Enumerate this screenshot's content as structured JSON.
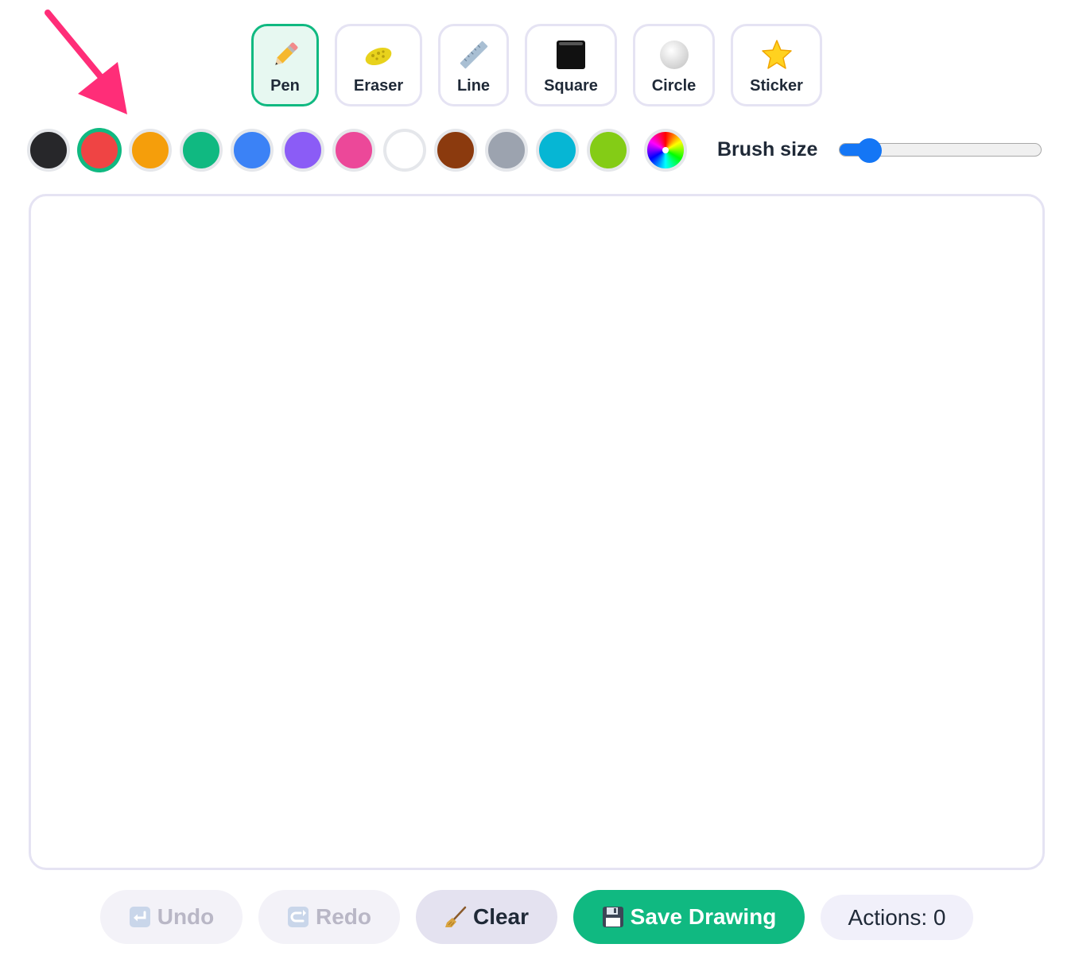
{
  "tools": [
    {
      "label": "Pen",
      "icon": "pencil-icon",
      "active": true
    },
    {
      "label": "Eraser",
      "icon": "sponge-icon",
      "active": false
    },
    {
      "label": "Line",
      "icon": "ruler-icon",
      "active": false
    },
    {
      "label": "Square",
      "icon": "black-square-icon",
      "active": false
    },
    {
      "label": "Circle",
      "icon": "white-circle-icon",
      "active": false
    },
    {
      "label": "Sticker",
      "icon": "star-icon",
      "active": false
    }
  ],
  "colors": [
    "#27272a",
    "#ef4444",
    "#f59e0b",
    "#10b981",
    "#3b82f6",
    "#8b5cf6",
    "#ec4899",
    "#ffffff",
    "#8b3a0e",
    "#9ca3af",
    "#06b6d4",
    "#84cc16"
  ],
  "selected_color": "#ef4444",
  "custom_color_icon": "rainbow-wheel-icon",
  "brush": {
    "label": "Brush size",
    "value_fraction": 0.11
  },
  "buttons": {
    "undo": {
      "label": "Undo",
      "icon": "undo-icon",
      "enabled": false
    },
    "redo": {
      "label": "Redo",
      "icon": "redo-icon",
      "enabled": false
    },
    "clear": {
      "label": "Clear",
      "icon": "broom-icon",
      "enabled": true
    },
    "save": {
      "label": "Save Drawing",
      "icon": "floppy-disk-icon",
      "enabled": true
    }
  },
  "actions_counter": "Actions: 0",
  "annotation": {
    "icon": "pointer-arrow-icon",
    "color": "#ff2d78"
  }
}
